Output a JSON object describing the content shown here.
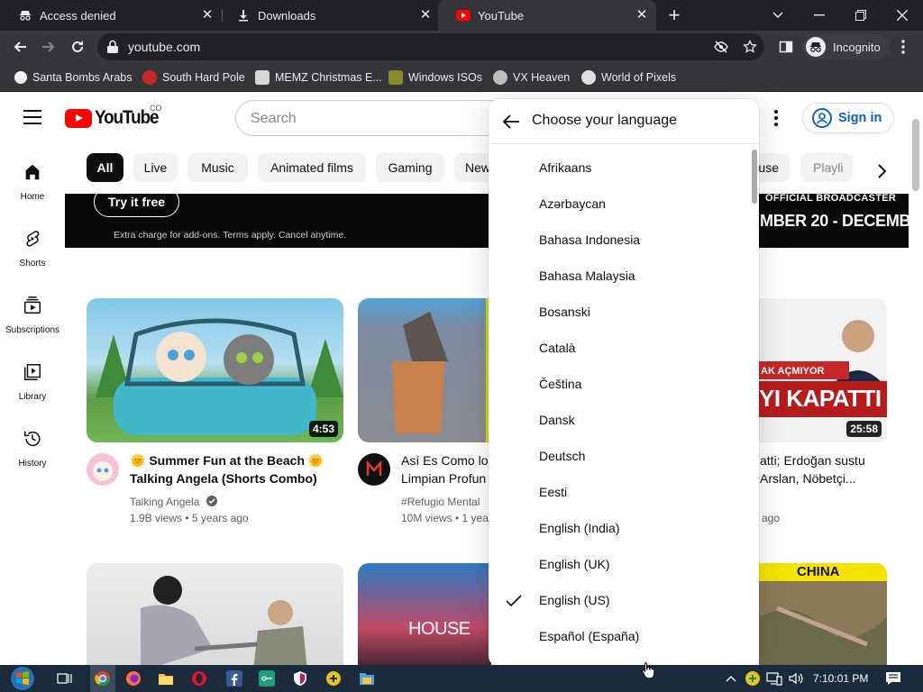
{
  "browser": {
    "tabs": [
      {
        "title": "Access denied",
        "icon": "incognito-icon"
      },
      {
        "title": "Downloads",
        "icon": "download-icon"
      },
      {
        "title": "YouTube",
        "icon": "youtube-icon"
      }
    ],
    "url": "youtube.com",
    "incognito_label": "Incognito",
    "bookmarks": [
      "Santa Bombs Arabs",
      "South Hard Pole",
      "MEMZ Christmas E...",
      "Windows ISOs",
      "VX Heaven",
      "World of Pixels"
    ]
  },
  "youtube": {
    "logo_text": "YouTube",
    "country_code": "CO",
    "search_placeholder": "Search",
    "sign_in_label": "Sign in",
    "chips": [
      "All",
      "Live",
      "Music",
      "Animated films",
      "Gaming",
      "New",
      "ouse",
      "Playli"
    ],
    "sidebar": [
      {
        "label": "Home",
        "icon": "home-icon"
      },
      {
        "label": "Shorts",
        "icon": "shorts-icon"
      },
      {
        "label": "Subscriptions",
        "icon": "subscriptions-icon"
      },
      {
        "label": "Library",
        "icon": "library-icon"
      },
      {
        "label": "History",
        "icon": "history-icon"
      }
    ],
    "banner": {
      "cta": "Try it free",
      "fine_print": "Extra charge for add-ons. Terms apply. Cancel anytime.",
      "official": "OFFICIAL BROADCASTER",
      "dates": "MBER 20 - DECEMB"
    },
    "videos": [
      {
        "title_line1": "🌞 Summer Fun at the Beach 🌞",
        "title_line2": "Talking Angela (Shorts Combo)",
        "channel": "Talking Angela",
        "meta": "1.9B views • 5 years ago",
        "duration": "4:53"
      },
      {
        "title_line1": "Así Es Como los",
        "title_line2": "Limpian Profun",
        "channel": "#Refugio Mental",
        "meta": "10M views • 1 yea"
      },
      {
        "title_line1": "atti; Erdoğan sustu",
        "title_line2": "Arslan, Nöbetçi...",
        "meta": "ago",
        "duration": "25:58",
        "thumb_text_top": "AK AÇMIYOR",
        "thumb_text_big": "YI KAPATTI"
      }
    ],
    "row2": {
      "house_text": "HOUSE",
      "china_text": "CHINA"
    }
  },
  "language_menu": {
    "title": "Choose your language",
    "selected": "English (US)",
    "languages": [
      "Afrikaans",
      "Azərbaycan",
      "Bahasa Indonesia",
      "Bahasa Malaysia",
      "Bosanski",
      "Català",
      "Čeština",
      "Dansk",
      "Deutsch",
      "Eesti",
      "English (India)",
      "English (UK)",
      "English (US)",
      "Español (España)"
    ]
  },
  "taskbar": {
    "time": "7:10:01 PM"
  }
}
